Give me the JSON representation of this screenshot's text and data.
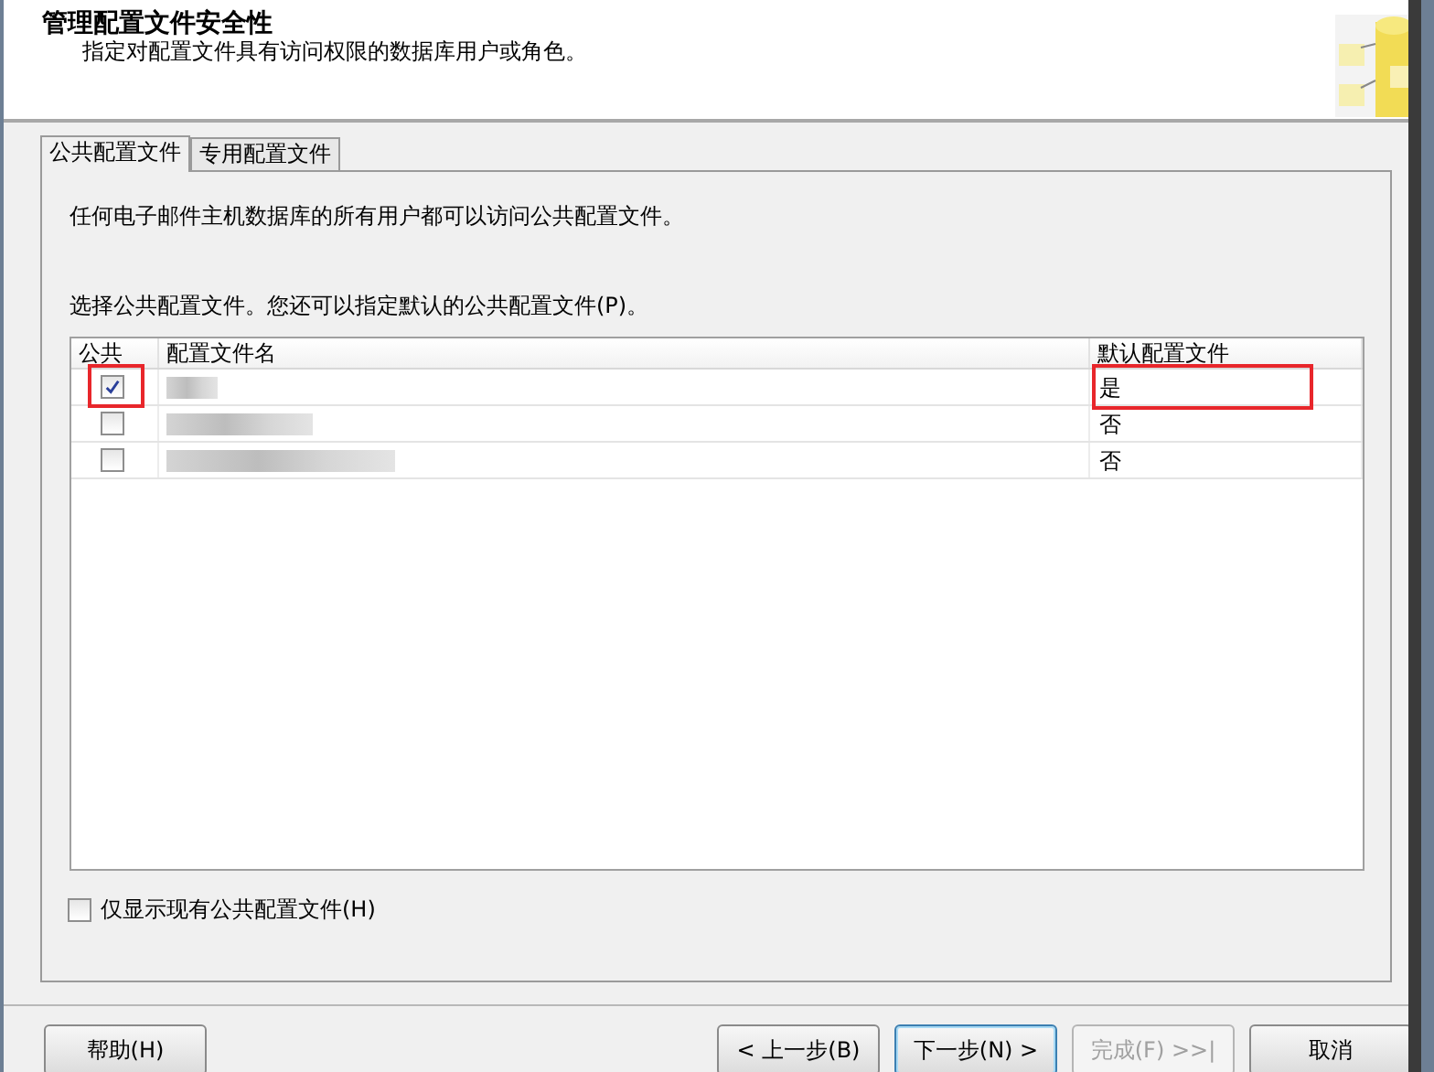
{
  "header": {
    "title": "管理配置文件安全性",
    "subtitle": "指定对配置文件具有访问权限的数据库用户或角色。"
  },
  "tabs": [
    {
      "label": "公共配置文件",
      "selected": true
    },
    {
      "label": "专用配置文件",
      "selected": false
    }
  ],
  "intro": "任何电子邮件主机数据库的所有用户都可以访问公共配置文件。",
  "instruction": "选择公共配置文件。您还可以指定默认的公共配置文件(P)。",
  "table": {
    "columns": [
      "公共",
      "配置文件名",
      "默认配置文件"
    ],
    "rows": [
      {
        "public": true,
        "default": "是",
        "highlighted": true
      },
      {
        "public": false,
        "default": "否",
        "highlighted": false
      },
      {
        "public": false,
        "default": "否",
        "highlighted": false
      }
    ]
  },
  "show_existing": {
    "label": "仅显示现有公共配置文件(H)",
    "checked": false
  },
  "buttons": [
    {
      "label": "帮助(H)",
      "disabled": false,
      "default": false
    },
    {
      "label": "< 上一步(B)",
      "disabled": false,
      "default": false
    },
    {
      "label": "下一步(N) >",
      "disabled": false,
      "default": true
    },
    {
      "label": "完成(F) >>|",
      "disabled": true,
      "default": false
    },
    {
      "label": "取消",
      "disabled": false,
      "default": false
    }
  ]
}
